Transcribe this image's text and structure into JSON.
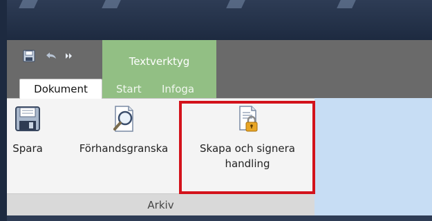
{
  "qat": {
    "save_icon": "floppy-disk-icon",
    "undo_icon": "undo-arrow-icon",
    "more_icon": "double-chevron-right-icon"
  },
  "contextual_group": {
    "label": "Textverktyg"
  },
  "tabs": [
    {
      "label": "Dokument",
      "active": true
    },
    {
      "label": "Start",
      "active": false
    },
    {
      "label": "Infoga",
      "active": false
    }
  ],
  "ribbon": {
    "buttons": [
      {
        "label": "Spara",
        "icon": "floppy-disk-icon"
      },
      {
        "label": "Förhandsgranska",
        "icon": "document-magnifier-icon"
      },
      {
        "label_line1": "Skapa och signera",
        "label_line2": "handling",
        "icon": "document-lock-icon",
        "highlighted": true
      }
    ],
    "group_label": "Arkiv"
  },
  "colors": {
    "titlebar": "#1d2a40",
    "contextual": "#92bf84",
    "highlight": "#d3121b",
    "blue_panel": "#c7ddf4"
  }
}
